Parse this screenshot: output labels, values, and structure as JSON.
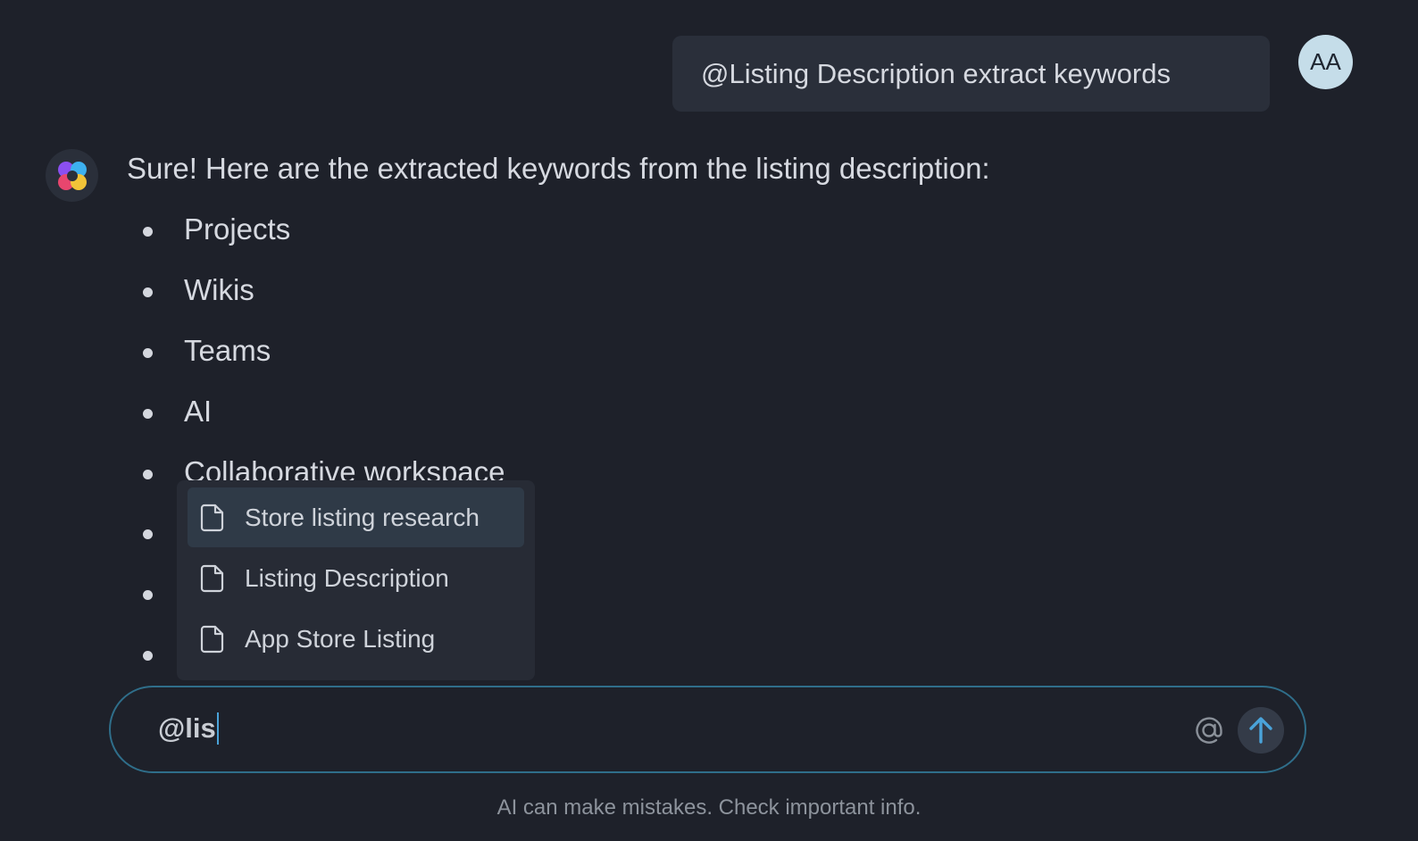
{
  "user_message": {
    "text": "@Listing Description extract keywords",
    "avatar_initials": "AA"
  },
  "assistant_message": {
    "intro": "Sure! Here are the extracted keywords from the listing description:",
    "keywords": [
      "Projects",
      "Wikis",
      "Teams",
      "AI",
      "Collaborative workspace"
    ]
  },
  "mention_menu": {
    "items": [
      {
        "label": "Store listing research",
        "icon": "document-icon"
      },
      {
        "label": "Listing Description",
        "icon": "document-icon"
      },
      {
        "label": "App Store Listing",
        "icon": "document-icon"
      }
    ]
  },
  "composer": {
    "value": "@lis",
    "at_icon": "at-sign-icon",
    "send_icon": "arrow-up-icon"
  },
  "footer": {
    "disclaimer": "AI can make mistakes. Check important info."
  },
  "colors": {
    "background": "#1e212a",
    "composer_border": "#2f6e8a",
    "send_arrow": "#4aa3d9"
  }
}
